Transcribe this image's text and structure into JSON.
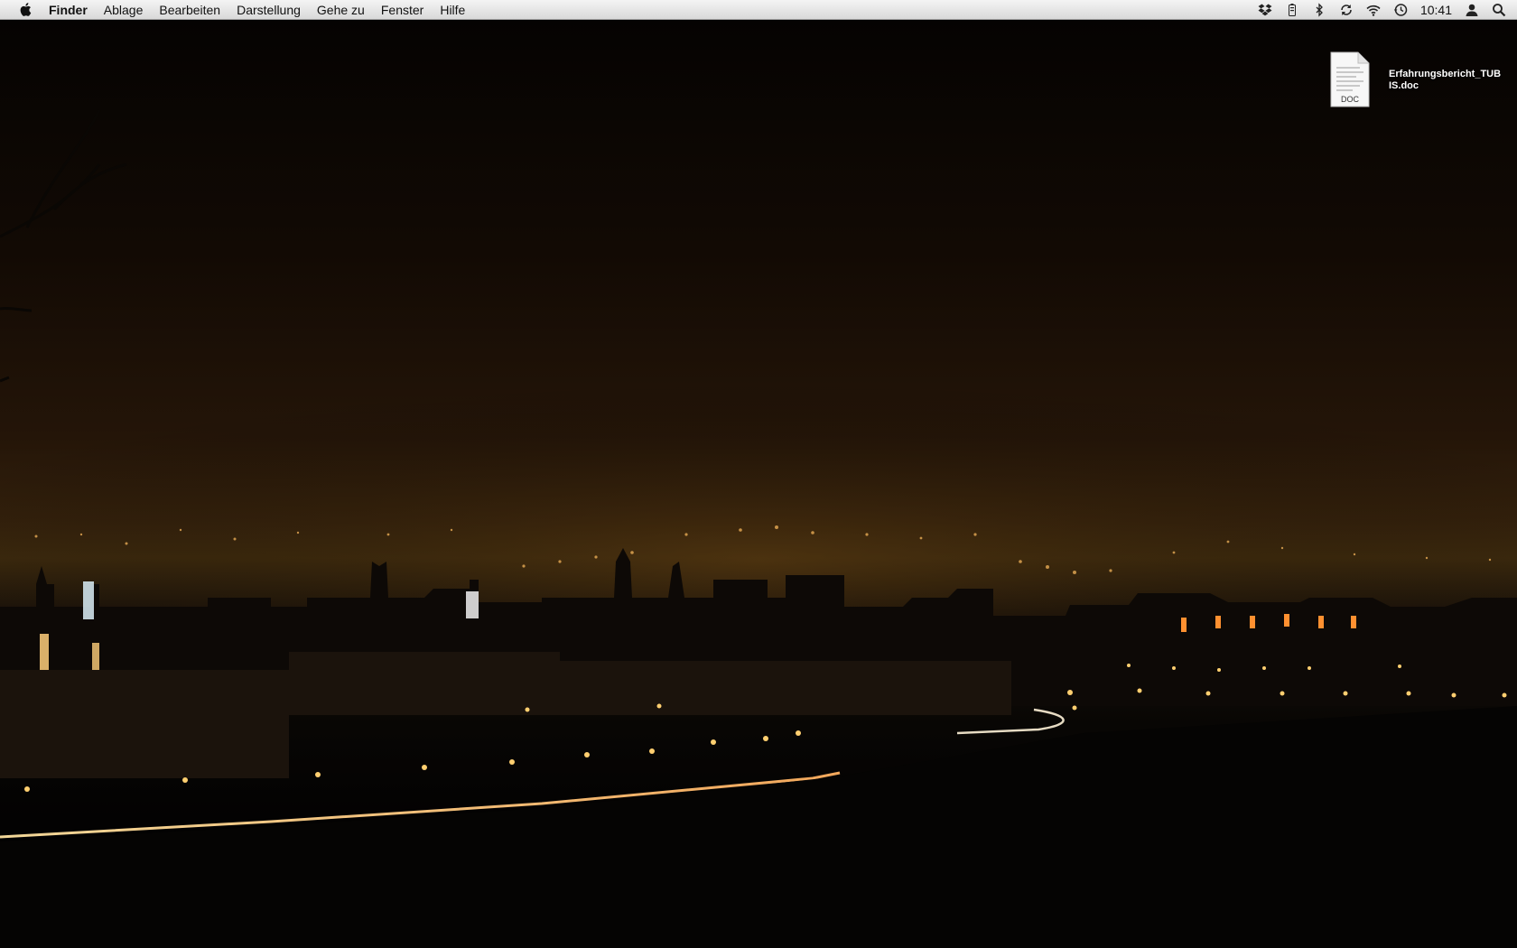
{
  "menubar": {
    "apple_icon": "apple-icon",
    "app_name": "Finder",
    "menus": [
      "Ablage",
      "Bearbeiten",
      "Darstellung",
      "Gehe zu",
      "Fenster",
      "Hilfe"
    ],
    "status_icons": [
      "dropbox-icon",
      "battery-icon",
      "bluetooth-icon",
      "sync-icon",
      "wifi-icon",
      "time-machine-icon"
    ],
    "clock": "10:41",
    "user_icon": "user-icon",
    "search_icon": "spotlight-search-icon"
  },
  "desktop": {
    "wallpaper": "night-city-skyline",
    "files": [
      {
        "name": "Erfahrungsbericht_TUBIS.doc",
        "type_label": "DOC",
        "icon": "doc-file-icon"
      }
    ]
  }
}
